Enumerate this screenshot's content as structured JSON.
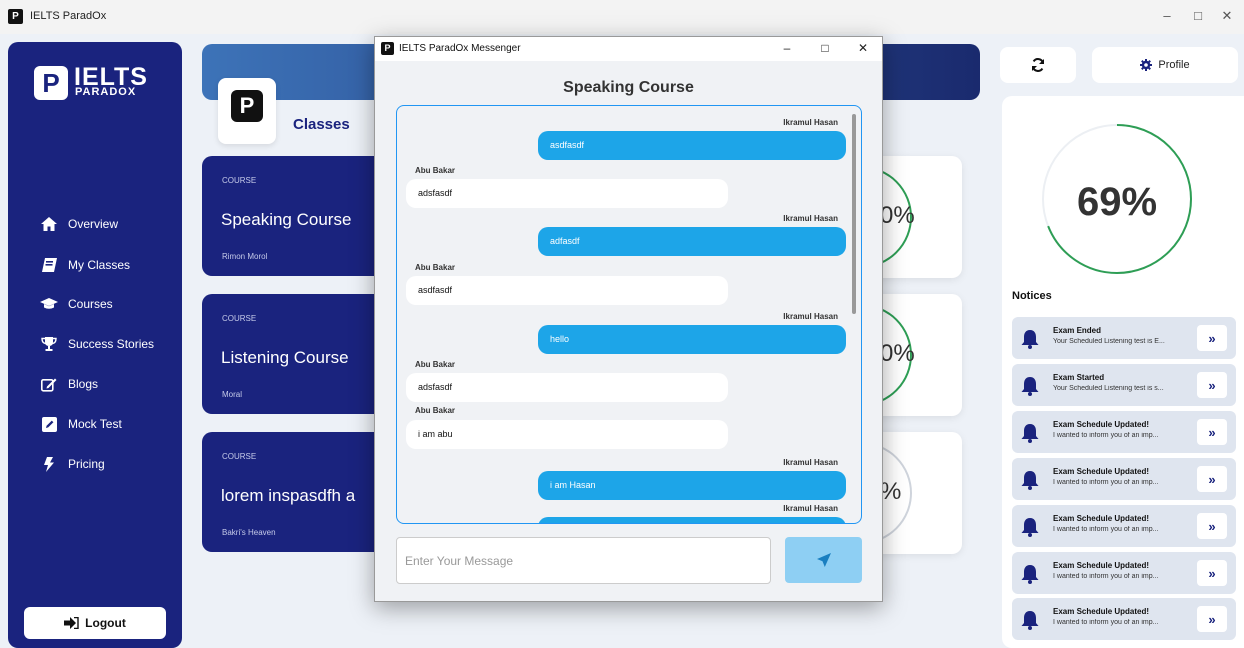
{
  "window": {
    "title": "IELTS ParadOx"
  },
  "sidebar": {
    "logo_line1": "IELTS",
    "logo_line2": "PARADOX",
    "items": [
      {
        "label": "Overview",
        "icon": "home-icon"
      },
      {
        "label": "My Classes",
        "icon": "book-icon"
      },
      {
        "label": "Courses",
        "icon": "graduation-cap-icon"
      },
      {
        "label": "Success Stories",
        "icon": "trophy-icon"
      },
      {
        "label": "Blogs",
        "icon": "edit-icon"
      },
      {
        "label": "Mock Test",
        "icon": "pencil-square-icon"
      },
      {
        "label": "Pricing",
        "icon": "bolt-icon"
      }
    ],
    "logout_label": "Logout"
  },
  "main": {
    "classes_title": "Classes",
    "courses": [
      {
        "label": "COURSE",
        "name": "Speaking Course",
        "teacher": "Rimon Morol",
        "progress_text": "0%"
      },
      {
        "label": "COURSE",
        "name": "Listening Course",
        "teacher": "Moral",
        "progress_text": "0%"
      },
      {
        "label": "COURSE",
        "name": "lorem inspasdfh a",
        "teacher": "Bakri's Heaven",
        "progress_text": "%"
      }
    ]
  },
  "right": {
    "profile_label": "Profile",
    "overall_progress": "69%",
    "overall_progress_value": 0.69,
    "notices_title": "Notices",
    "notices": [
      {
        "title": "Exam Ended",
        "body": "Your Scheduled Listening test is E..."
      },
      {
        "title": "Exam Started",
        "body": "Your Scheduled Listening test is s..."
      },
      {
        "title": "Exam Schedule Updated!",
        "body": "I wanted to inform you of an imp..."
      },
      {
        "title": "Exam Schedule Updated!",
        "body": "I wanted to inform you of an imp..."
      },
      {
        "title": "Exam Schedule Updated!",
        "body": "I wanted to inform you of an imp..."
      },
      {
        "title": "Exam Schedule Updated!",
        "body": "I wanted to inform you of an imp..."
      },
      {
        "title": "Exam Schedule Updated!",
        "body": "I wanted to inform you of an imp..."
      }
    ]
  },
  "messenger": {
    "window_title": "IELTS ParadOx Messenger",
    "heading": "Speaking Course",
    "messages": [
      {
        "sender": "Ikramul Hasan",
        "text": "asdfasdf",
        "mine": true
      },
      {
        "sender": "Abu Bakar",
        "text": "adsfasdf",
        "mine": false
      },
      {
        "sender": "Ikramul Hasan",
        "text": "adfasdf",
        "mine": true
      },
      {
        "sender": "Abu Bakar",
        "text": "asdfasdf",
        "mine": false
      },
      {
        "sender": "Ikramul Hasan",
        "text": "hello",
        "mine": true
      },
      {
        "sender": "Abu Bakar",
        "text": "adsfasdf",
        "mine": false
      },
      {
        "sender": "Abu Bakar",
        "text": "i am abu",
        "mine": false
      },
      {
        "sender": "Ikramul Hasan",
        "text": "i am Hasan",
        "mine": true
      },
      {
        "sender": "Ikramul Hasan",
        "text": "",
        "mine": true
      }
    ],
    "input_placeholder": "Enter Your Message"
  }
}
